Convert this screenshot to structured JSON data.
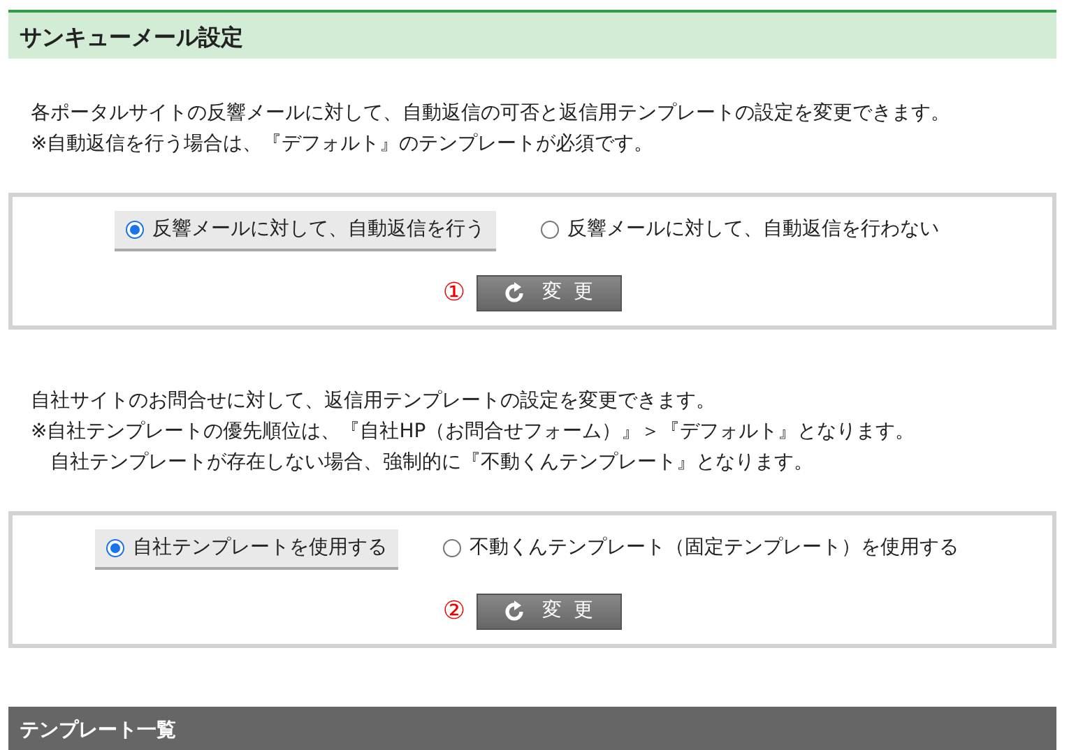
{
  "header": {
    "title": "サンキューメール設定"
  },
  "sections": [
    {
      "description": [
        "各ポータルサイトの反響メールに対して、自動返信の可否と返信用テンプレートの設定を変更できます。",
        "※自動返信を行う場合は、『デフォルト』のテンプレートが必須です。"
      ],
      "options": [
        {
          "label": "反響メールに対して、自動返信を行う",
          "selected": true
        },
        {
          "label": "反響メールに対して、自動返信を行わない",
          "selected": false
        }
      ],
      "step": "①",
      "button": "変 更"
    },
    {
      "description": [
        "自社サイトのお問合せに対して、返信用テンプレートの設定を変更できます。",
        "※自社テンプレートの優先順位は、『自社HP（お問合せフォーム）』＞『デフォルト』となります。",
        "　自社テンプレートが存在しない場合、強制的に『不動くんテンプレート』となります。"
      ],
      "options": [
        {
          "label": "自社テンプレートを使用する",
          "selected": true
        },
        {
          "label": "不動くんテンプレート（固定テンプレート）を使用する",
          "selected": false
        }
      ],
      "step": "②",
      "button": "変 更"
    }
  ],
  "footer_header": {
    "title": "テンプレート一覧"
  }
}
